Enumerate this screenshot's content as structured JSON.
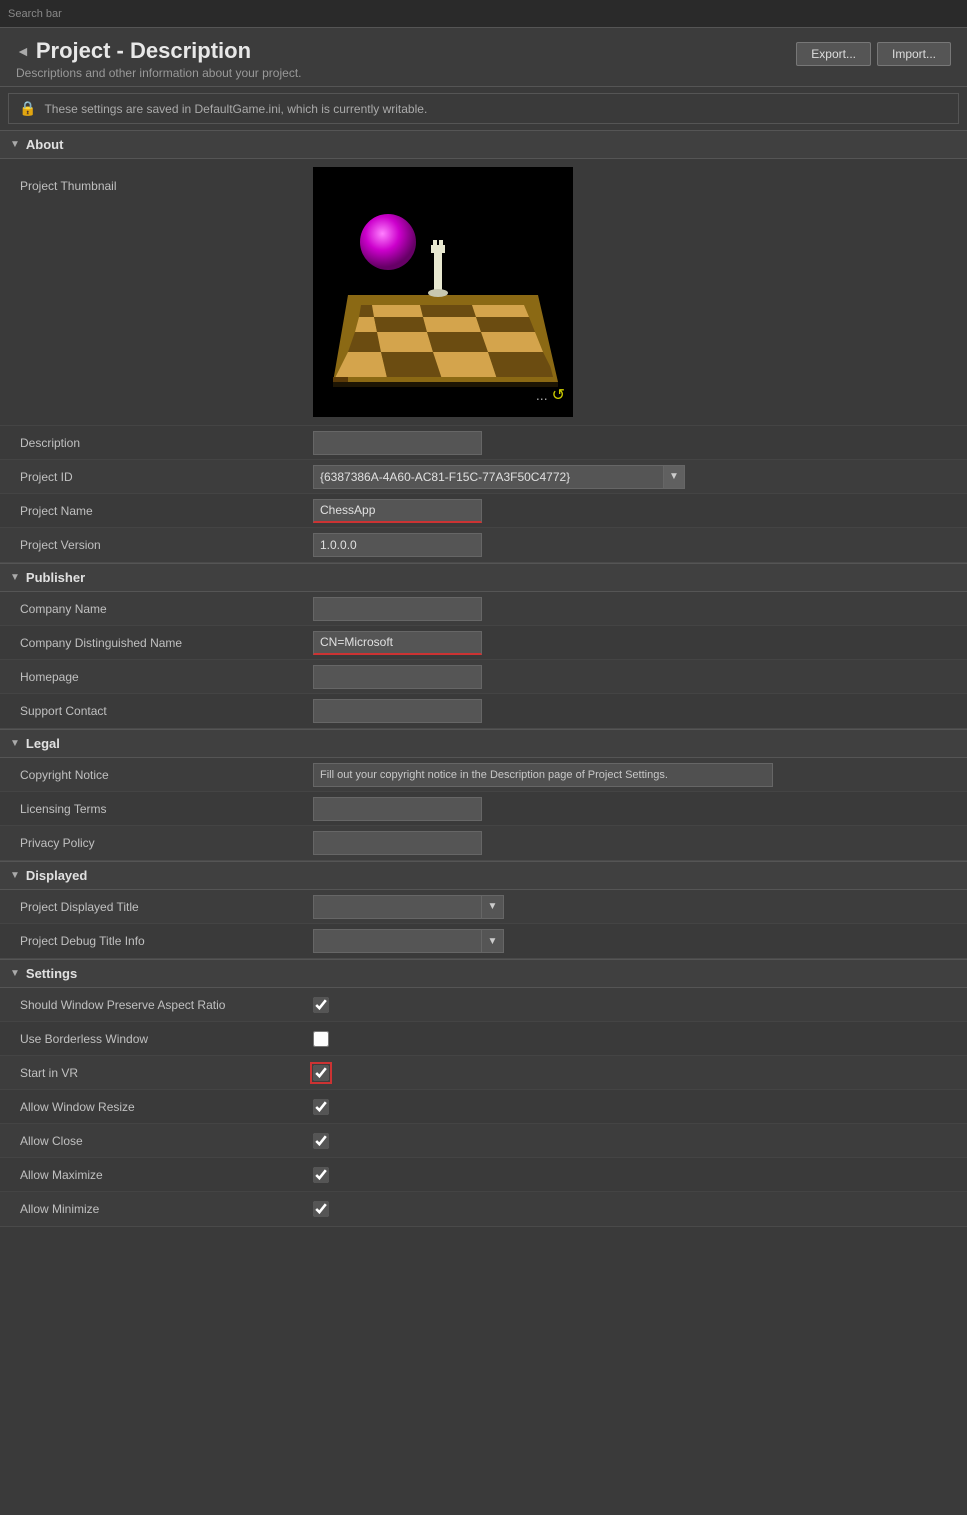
{
  "page": {
    "title": "Project - Description",
    "subtitle": "Descriptions and other information about your project.",
    "info_bar": "These settings are saved in DefaultGame.ini, which is currently writable.",
    "export_label": "Export...",
    "import_label": "Import..."
  },
  "sections": {
    "about": {
      "label": "About",
      "fields": {
        "thumbnail_label": "Project Thumbnail",
        "description_label": "Description",
        "description_value": "",
        "project_id_label": "Project ID",
        "project_id_value": "{6387386A-4A60-AC81-F15C-77A3F50C4772}",
        "project_name_label": "Project Name",
        "project_name_value": "ChessApp",
        "project_version_label": "Project Version",
        "project_version_value": "1.0.0.0"
      }
    },
    "publisher": {
      "label": "Publisher",
      "fields": {
        "company_name_label": "Company Name",
        "company_name_value": "",
        "company_dn_label": "Company Distinguished Name",
        "company_dn_value": "CN=Microsoft",
        "homepage_label": "Homepage",
        "homepage_value": "",
        "support_label": "Support Contact",
        "support_value": ""
      }
    },
    "legal": {
      "label": "Legal",
      "fields": {
        "copyright_label": "Copyright Notice",
        "copyright_value": "Fill out your copyright notice in the Description page of Project Settings.",
        "licensing_label": "Licensing Terms",
        "licensing_value": "",
        "privacy_label": "Privacy Policy",
        "privacy_value": ""
      }
    },
    "displayed": {
      "label": "Displayed",
      "fields": {
        "title_label": "Project Displayed Title",
        "title_value": "",
        "debug_label": "Project Debug Title Info",
        "debug_value": ""
      }
    },
    "settings": {
      "label": "Settings",
      "fields": {
        "preserve_aspect_label": "Should Window Preserve Aspect Ratio",
        "preserve_aspect_checked": true,
        "borderless_label": "Use Borderless Window",
        "borderless_checked": false,
        "start_vr_label": "Start in VR",
        "start_vr_checked": true,
        "allow_resize_label": "Allow Window Resize",
        "allow_resize_checked": true,
        "allow_close_label": "Allow Close",
        "allow_close_checked": true,
        "allow_maximize_label": "Allow Maximize",
        "allow_maximize_checked": true,
        "allow_minimize_label": "Allow Minimize",
        "allow_minimize_checked": true
      }
    }
  },
  "icons": {
    "arrow_down": "▼",
    "arrow_right": "▶",
    "lock": "🔒",
    "dots": "...",
    "refresh": "↺",
    "dropdown": "▼"
  }
}
